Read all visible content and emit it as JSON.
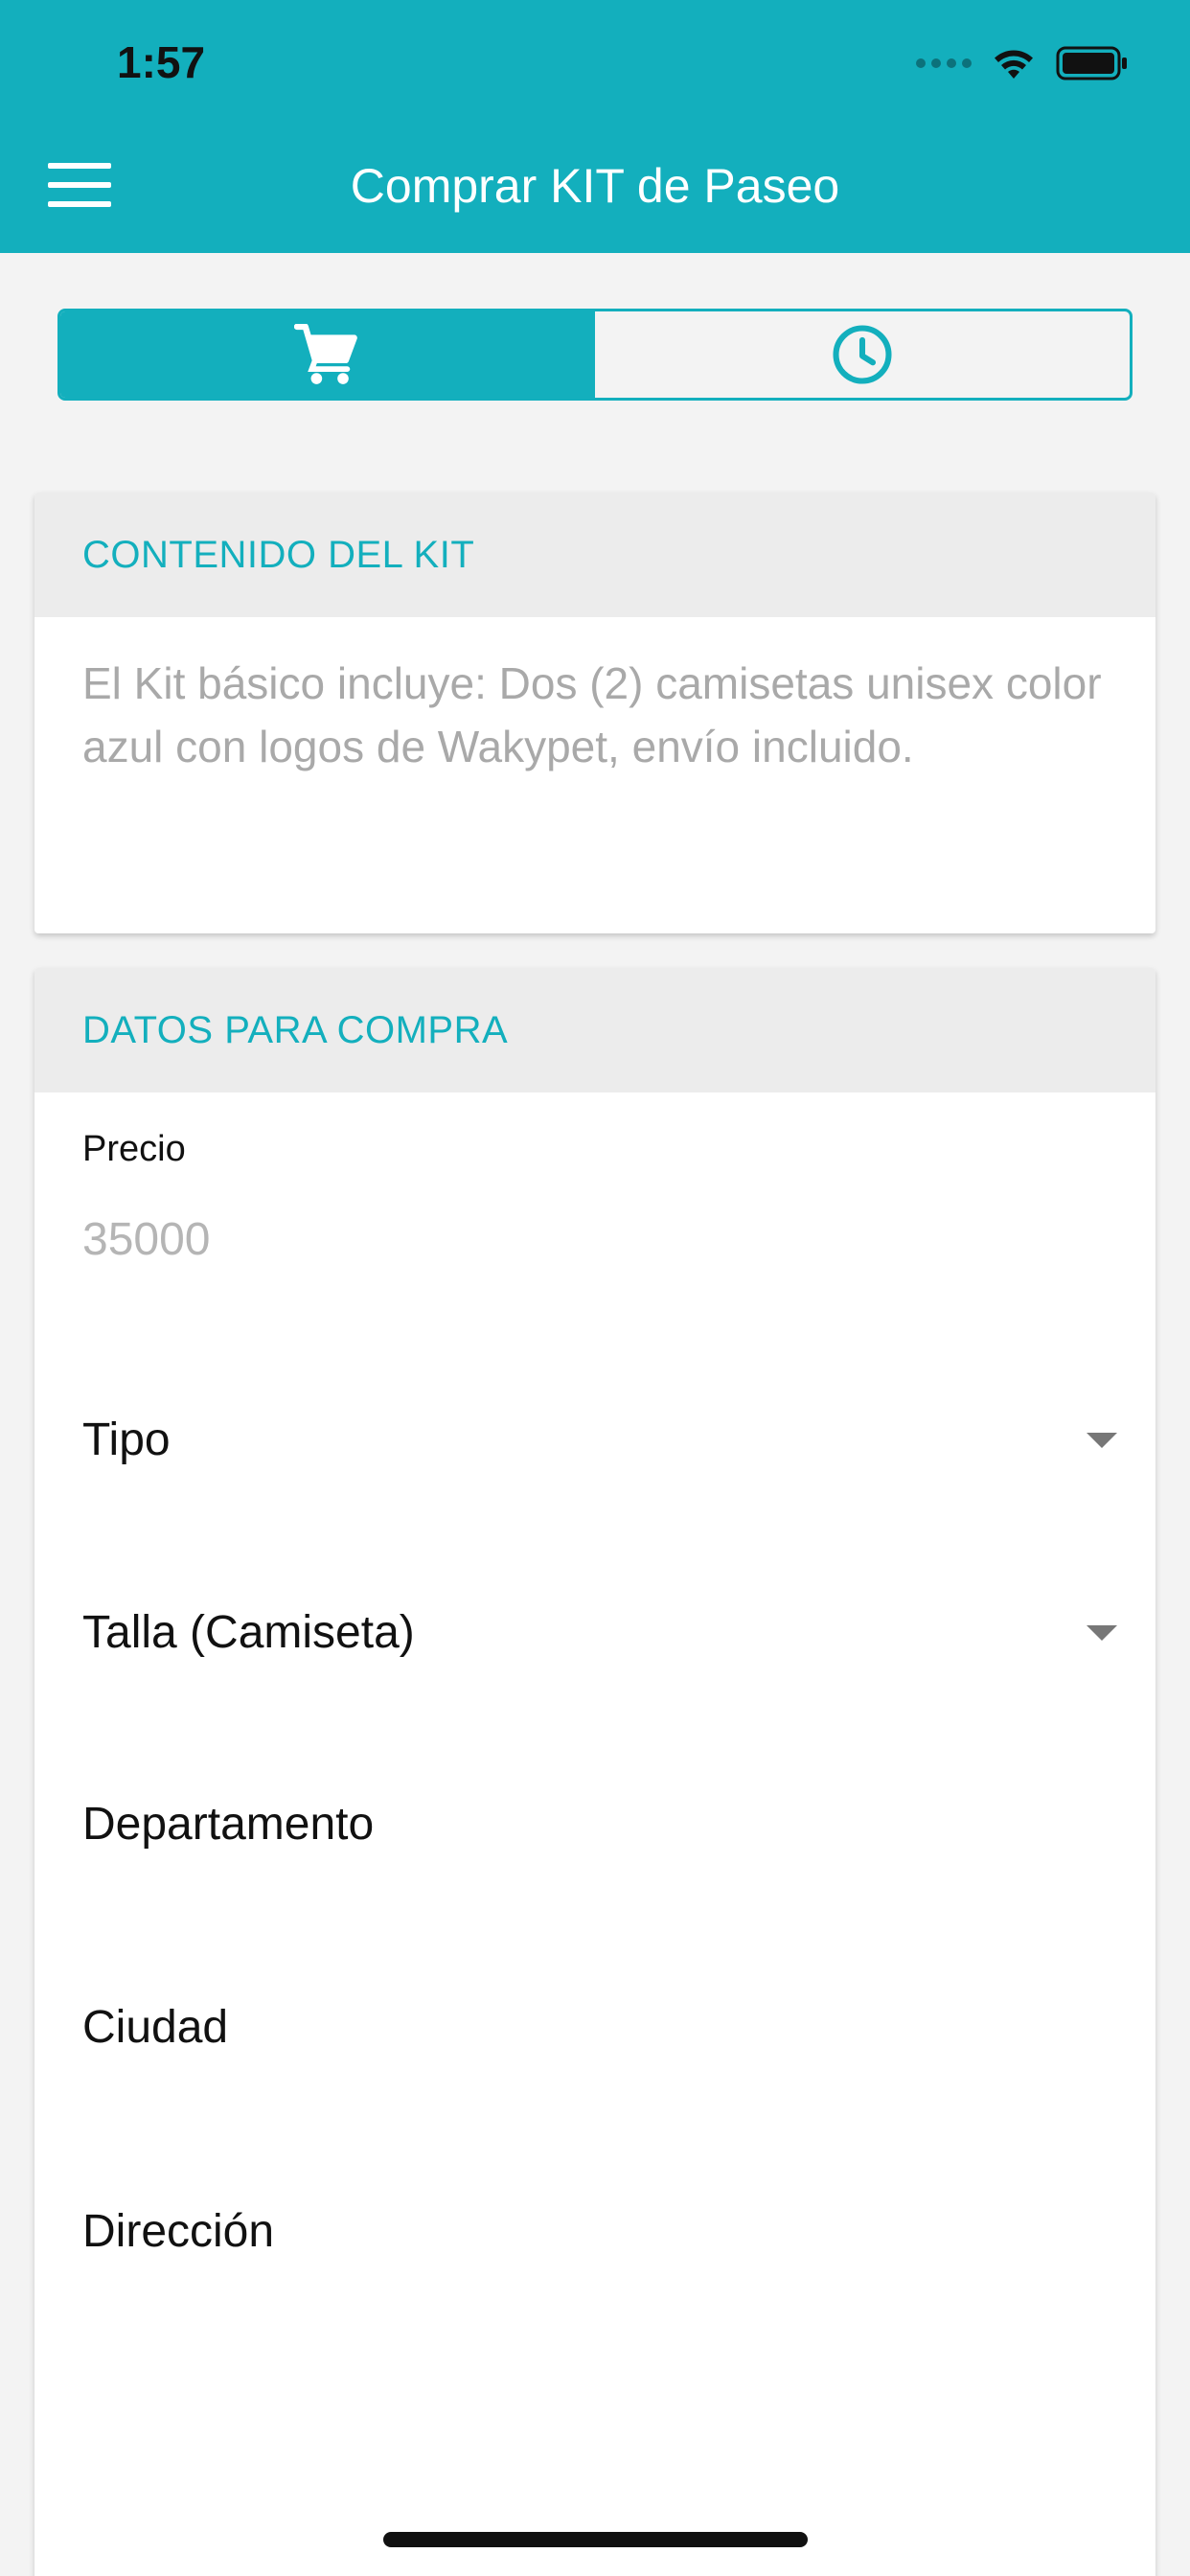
{
  "status_bar": {
    "time": "1:57"
  },
  "header": {
    "title": "Comprar KIT de Paseo",
    "menu_icon": "hamburger-menu-icon",
    "background_color": "#13afbd"
  },
  "segmented_control": {
    "tabs": [
      {
        "icon": "cart-icon",
        "active": true
      },
      {
        "icon": "clock-icon",
        "active": false
      }
    ]
  },
  "kit_card": {
    "title": "CONTENIDO DEL KIT",
    "description": "El Kit básico incluye: Dos (2) camisetas unisex color azul con logos de Wakypet, envío incluido."
  },
  "purchase_card": {
    "title": "DATOS PARA COMPRA",
    "price_label": "Precio",
    "price_value": "35000",
    "fields": {
      "tipo": "Tipo",
      "talla": "Talla (Camiseta)",
      "departamento": "Departamento",
      "ciudad": "Ciudad",
      "direccion": "Dirección"
    }
  }
}
